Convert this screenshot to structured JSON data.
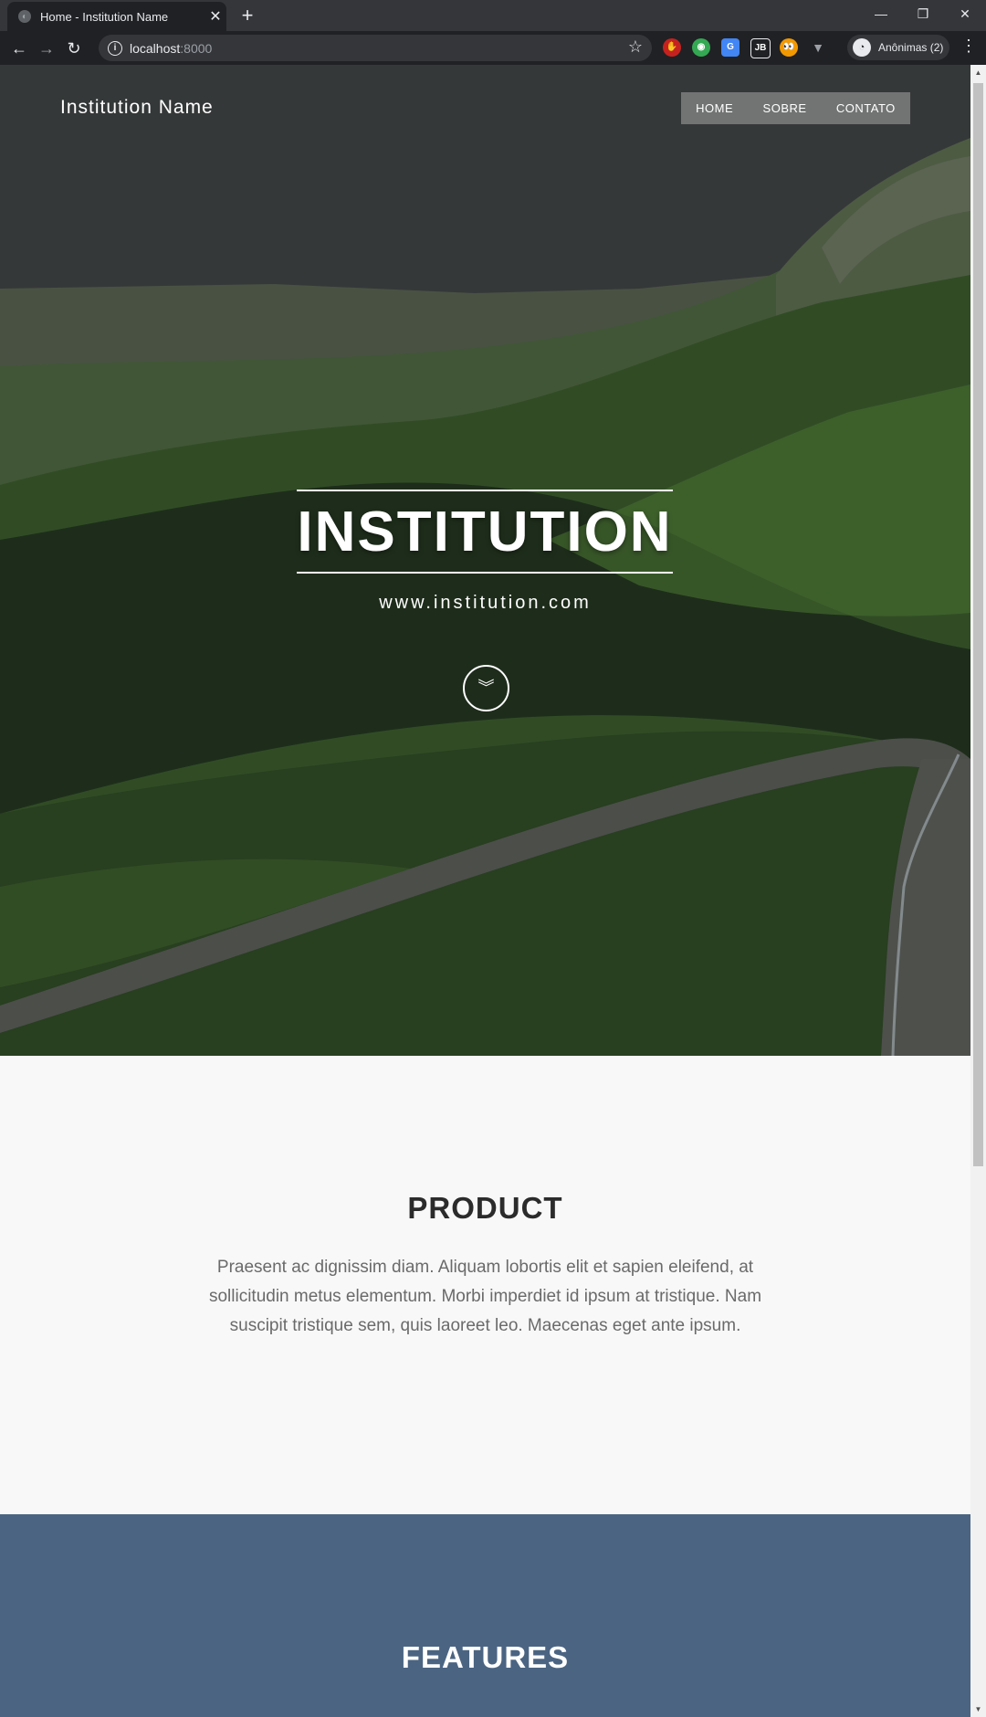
{
  "browser": {
    "tab_title": "Home - Institution Name",
    "tab_close": "✕",
    "new_tab": "+",
    "url_host": "localhost",
    "url_port": ":8000",
    "profile_label": "Anônimas (2)",
    "extensions": [
      "adblock-icon",
      "chrome-icon",
      "translate-icon",
      "jb-icon",
      "eyes-icon",
      "v-icon"
    ],
    "window_controls": [
      "minimize",
      "restore",
      "close"
    ]
  },
  "site": {
    "brand": "Institution Name",
    "nav": {
      "home": "HOME",
      "sobre": "SOBRE",
      "contato": "CONTATO"
    },
    "hero": {
      "title": "INSTITUTION",
      "subtitle": "www.institution.com"
    },
    "product": {
      "title": "PRODUCT",
      "text": "Praesent ac dignissim diam. Aliquam lobortis elit et sapien eleifend, at sollicitudin metus elementum. Morbi imperdiet id ipsum at tristique. Nam suscipit tristique sem, quis laoreet leo. Maecenas eget ante ipsum."
    },
    "features": {
      "title": "FEATURES"
    }
  },
  "colors": {
    "features_bg": "#4b6482",
    "product_bg": "#f8f8f8",
    "chrome_bg": "#202124"
  }
}
